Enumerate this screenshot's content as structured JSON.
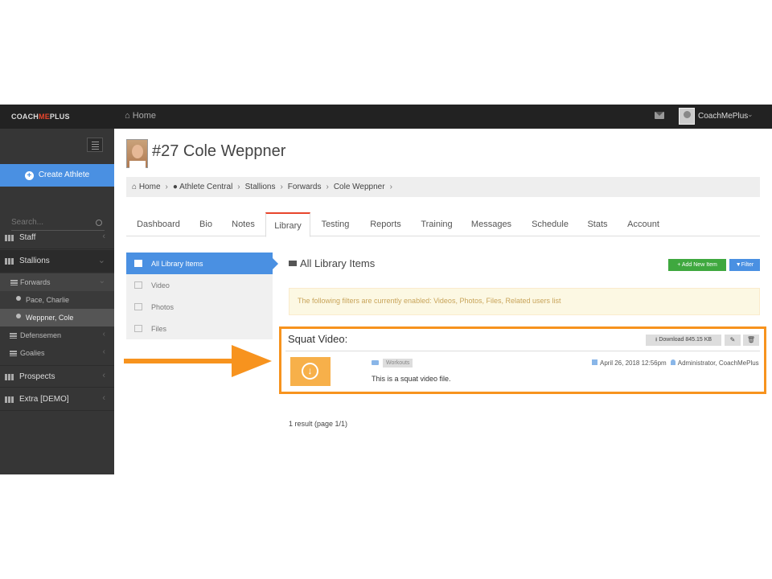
{
  "topbar": {
    "logo_a": "COACH",
    "logo_b": "ME",
    "logo_c": "PLUS",
    "home_label": "Home",
    "user_name": "CoachMePlus"
  },
  "sidebar": {
    "create_label": "Create Athlete",
    "search_placeholder": "Search...",
    "nav": [
      {
        "label": "Staff"
      },
      {
        "label": "Stallions"
      },
      {
        "label": "Prospects"
      },
      {
        "label": "Extra [DEMO]"
      }
    ],
    "sub": [
      {
        "label": "Forwards"
      },
      {
        "label": "Pace, Charlie"
      },
      {
        "label": "Weppner, Cole"
      },
      {
        "label": "Defensemen"
      },
      {
        "label": "Goalies"
      }
    ]
  },
  "page": {
    "title": "#27 Cole Weppner",
    "breadcrumb": [
      "Home",
      "Athlete Central",
      "Stallions",
      "Forwards",
      "Cole Weppner"
    ],
    "tabs": [
      "Dashboard",
      "Bio",
      "Notes",
      "Library",
      "Testing",
      "Reports",
      "Training",
      "Messages",
      "Schedule",
      "Stats",
      "Account"
    ],
    "active_tab": "Library"
  },
  "library": {
    "menu": [
      "All Library Items",
      "Video",
      "Photos",
      "Files"
    ],
    "section_title": "All Library Items",
    "add_label": "Add New Item",
    "filter_label": "Filter",
    "notice": "The following filters are currently enabled: Videos, Photos, Files, Related users list",
    "item": {
      "title": "Squat Video:",
      "download_label": "Download 845.15 KB",
      "tag": "Workouts",
      "date": "April 26, 2018 12:56pm",
      "author": "Administrator, CoachMePlus",
      "description": "This is a squat video file."
    },
    "results": "1 result (page 1/1)"
  },
  "colors": {
    "accent": "#4a90e2",
    "highlight": "#f7931e",
    "success": "#3fa83f",
    "brand": "#e8452c"
  }
}
